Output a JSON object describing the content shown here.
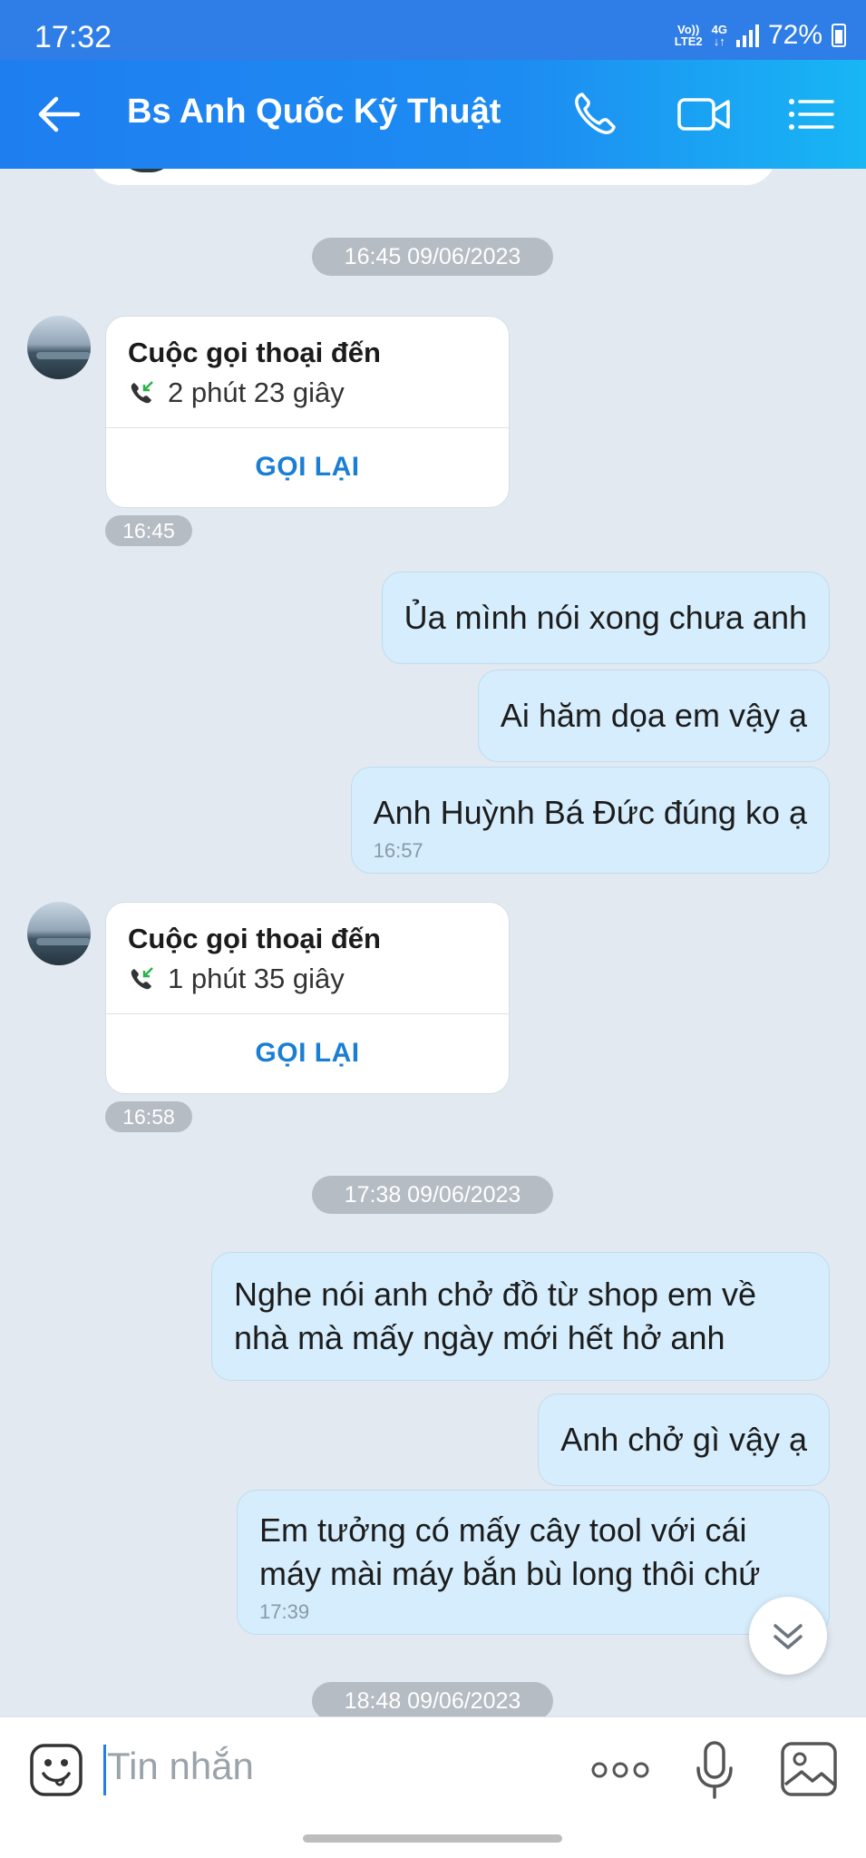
{
  "status_bar": {
    "time": "17:32",
    "network_top": "Vo))",
    "network_bottom": "LTE2",
    "network_type": "4G",
    "battery": "72%"
  },
  "header": {
    "title": "Bs Anh Quốc Kỹ Thuật",
    "icons": [
      "back-arrow-icon",
      "phone-icon",
      "video-call-icon",
      "menu-list-icon"
    ]
  },
  "chat": {
    "date_separators": [
      "16:45 09/06/2023",
      "17:38 09/06/2023",
      "18:48 09/06/2023"
    ],
    "call_1": {
      "title": "Cuộc gọi thoại đến",
      "duration": "2 phút 23 giây",
      "action": "GỌI LẠI",
      "time": "16:45"
    },
    "call_2": {
      "title": "Cuộc gọi thoại đến",
      "duration": "1 phút 35 giây",
      "action": "GỌI LẠI",
      "time": "16:58"
    },
    "messages": [
      {
        "text": "Ủa mình nói xong chưa anh"
      },
      {
        "text": "Ai hăm dọa em vậy ạ"
      },
      {
        "text": "Anh Huỳnh Bá Đức đúng ko ạ",
        "time": "16:57"
      },
      {
        "text": "Nghe nói anh chở đồ từ shop em về nhà mà mấy ngày mới hết hở anh"
      },
      {
        "text": "Anh chở gì vậy ạ"
      },
      {
        "text": "Em tưởng có mấy cây tool với cái máy mài máy bắn bù long thôi chứ",
        "time": "17:39"
      }
    ]
  },
  "input": {
    "placeholder": "Tin nhắn"
  },
  "colors": {
    "header_start": "#1e7ef0",
    "header_end": "#18b6f4",
    "chat_background": "#e2e9f1",
    "outgoing_bubble": "#d5edfc",
    "recall_text": "#1a7ed4"
  }
}
